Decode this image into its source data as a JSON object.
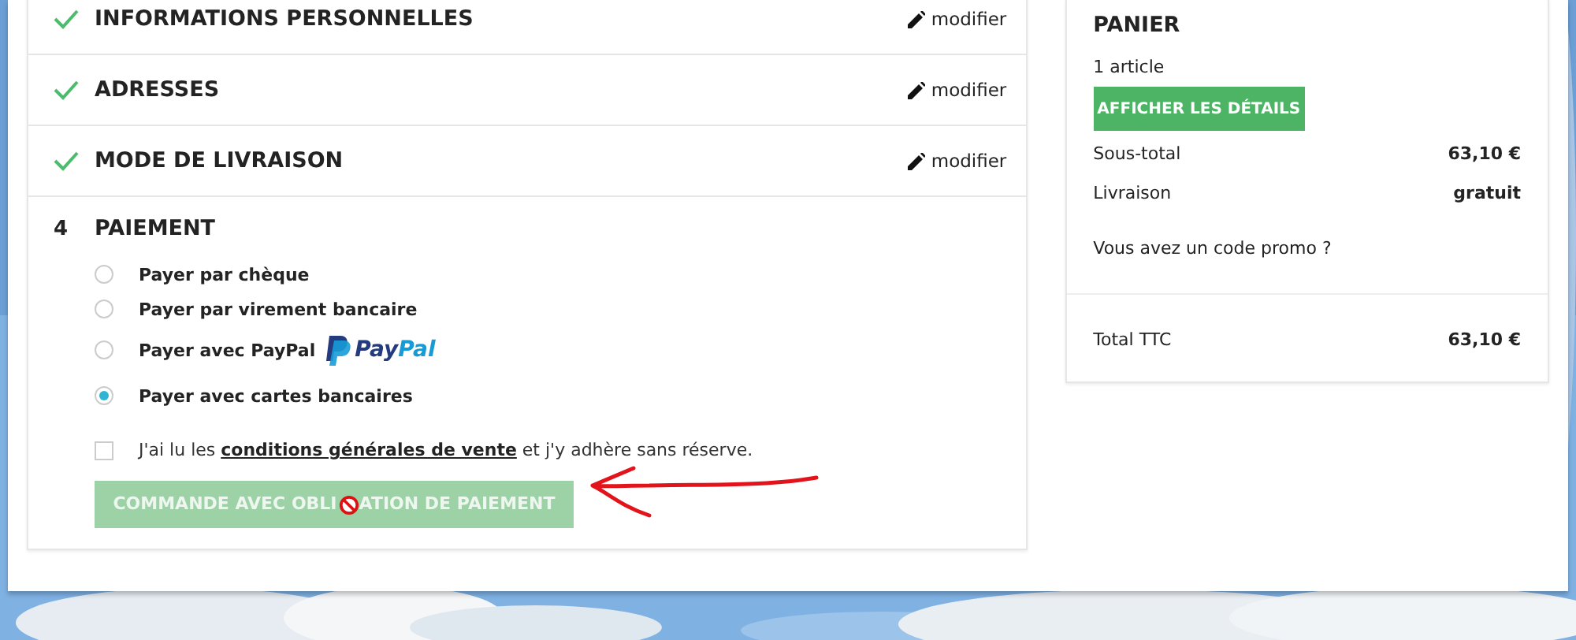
{
  "steps": [
    {
      "title": "INFORMATIONS PERSONNELLES",
      "done": true,
      "action": "modifier"
    },
    {
      "title": "ADRESSES",
      "done": true,
      "action": "modifier"
    },
    {
      "title": "MODE DE LIVRAISON",
      "done": true,
      "action": "modifier"
    }
  ],
  "payment": {
    "number": "4",
    "title": "PAIEMENT",
    "options": [
      {
        "label": "Payer par chèque",
        "selected": false
      },
      {
        "label": "Payer par virement bancaire",
        "selected": false
      },
      {
        "label": "Payer avec PayPal",
        "selected": false,
        "logo": [
          "Pay",
          "Pal"
        ]
      },
      {
        "label": "Payer avec cartes bancaires",
        "selected": true
      }
    ],
    "terms": {
      "checked": false,
      "before": "J'ai lu les",
      "link": "conditions générales de vente",
      "after": "et j'y adhère sans réserve."
    },
    "submit": {
      "label": "COMMANDE AVEC OBLI",
      "label_end": "ATION DE PAIEMENT",
      "disabled": true
    }
  },
  "cart": {
    "title": "PANIER",
    "count": "1 article",
    "details_button": "AFFICHER LES DÉTAILS",
    "lines": [
      {
        "label": "Sous-total",
        "value": "63,10 €"
      },
      {
        "label": "Livraison",
        "value": "gratuit"
      }
    ],
    "promo": "Vous avez un code promo ?",
    "total": {
      "label": "Total TTC",
      "value": "63,10 €"
    }
  }
}
